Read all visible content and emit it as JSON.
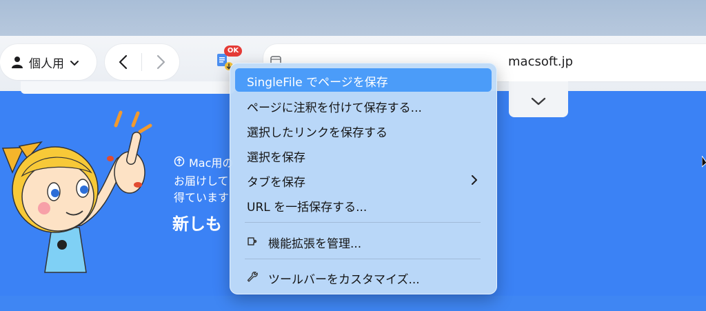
{
  "toolbar": {
    "profile_label": "個人用",
    "extension_badge": "OK"
  },
  "address_bar": {
    "url": "macsoft.jp"
  },
  "page": {
    "promo_line1": "Mac用の",
    "promo_line2": "お届けして",
    "promo_line3": "得ています",
    "headline": "新しも"
  },
  "context_menu": {
    "items": [
      {
        "label": "SingleFile でページを保存",
        "highlighted": true
      },
      {
        "label": "ページに注釈を付けて保存する..."
      },
      {
        "label": "選択したリンクを保存する"
      },
      {
        "label": "選択を保存"
      },
      {
        "label": "タブを保存",
        "submenu": true
      },
      {
        "label": "URL を一括保存する..."
      },
      {
        "label": "機能拡張を管理...",
        "icon": "extension-icon"
      },
      {
        "label": "ツールバーをカスタマイズ...",
        "icon": "wrench-icon"
      }
    ]
  },
  "colors": {
    "page_background": "#3b82f5",
    "menu_highlight": "#4b9cf9",
    "badge": "#e53b36"
  }
}
